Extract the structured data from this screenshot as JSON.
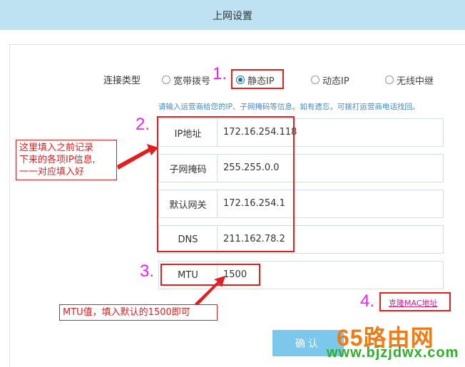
{
  "header": {
    "title": "上网设置"
  },
  "connection": {
    "label": "连接类型",
    "options": [
      {
        "label": "宽带拨号",
        "checked": false
      },
      {
        "label": "静态IP",
        "checked": true
      },
      {
        "label": "动态IP",
        "checked": false
      },
      {
        "label": "无线中继",
        "checked": false
      }
    ]
  },
  "hint": "请输入运营商给您的IP、子网掩码等信息。如有遗忘，可拨打运营商电话找回。",
  "fields": {
    "ip": {
      "label": "IP地址",
      "value": "172.16.254.118"
    },
    "mask": {
      "label": "子网掩码",
      "value": "255.255.0.0"
    },
    "gateway": {
      "label": "默认网关",
      "value": "172.16.254.1"
    },
    "dns": {
      "label": "DNS",
      "value": "211.162.78.2"
    },
    "mtu": {
      "label": "MTU",
      "value": "1500"
    }
  },
  "clone_mac_label": "克隆MAC地址",
  "confirm_label": "确认",
  "annotations": {
    "step1": "1.",
    "step2": "2.",
    "step3": "3.",
    "step4": "4.",
    "note_ip_line1": "这里填入之前记录",
    "note_ip_line2": "下来的各项IP信息,",
    "note_ip_line3": "一一对应填入好",
    "note_mtu": "MTU值，填入默认的1500即可"
  },
  "watermark": {
    "text": "65路由网",
    "url": "www.bjzjdwx.com"
  },
  "colors": {
    "annotation_red": "#e02020",
    "annotation_magenta": "#ee22ee",
    "hint_blue": "#3a8ed0",
    "button_blue": "#7cc7ec"
  }
}
